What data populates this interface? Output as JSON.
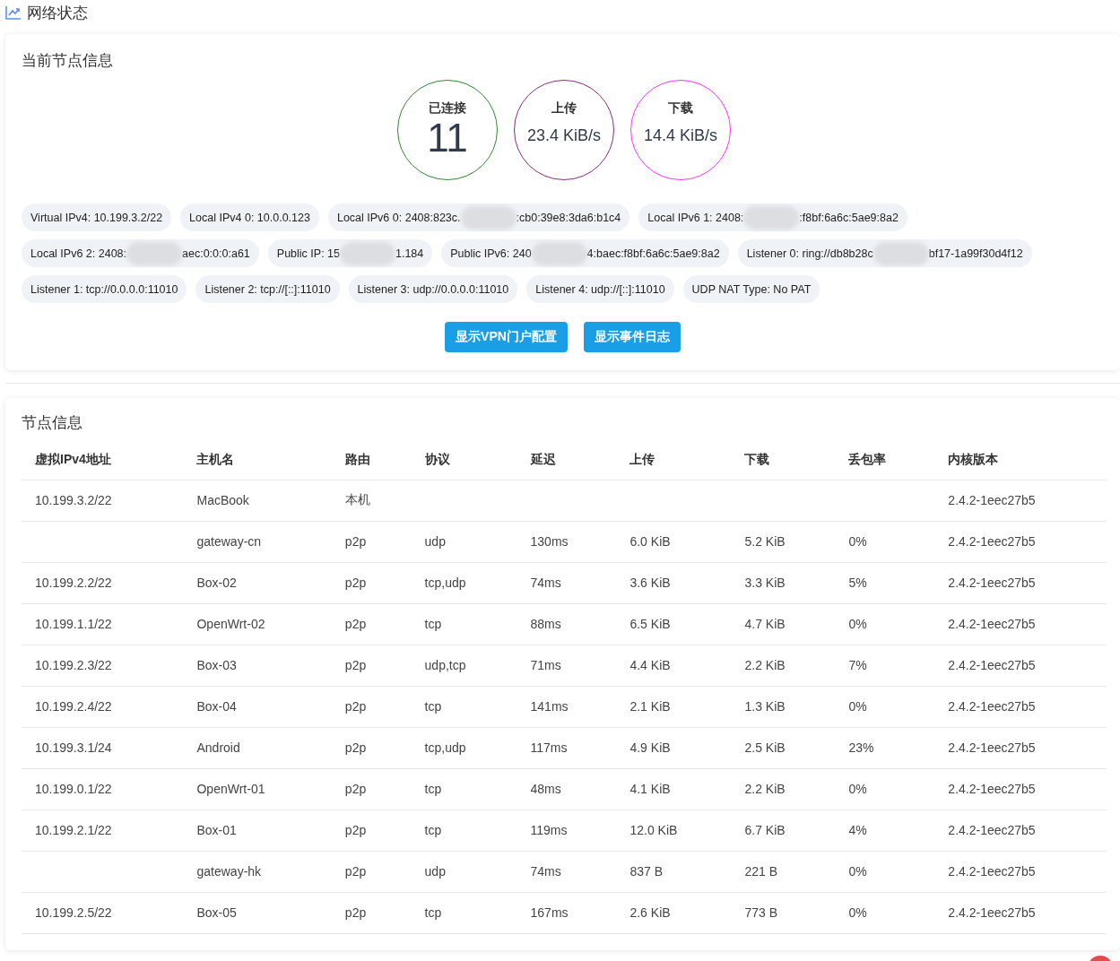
{
  "page_title": "网络状态",
  "node_card": {
    "title": "当前节点信息",
    "stats": [
      {
        "label": "已连接",
        "value": "11",
        "kind": "big",
        "color": "#2e8b2e"
      },
      {
        "label": "上传",
        "value": "23.4 KiB/s",
        "kind": "normal",
        "color": "#8b2a8b"
      },
      {
        "label": "下载",
        "value": "14.4 KiB/s",
        "kind": "normal",
        "color": "#ff33ff"
      }
    ],
    "chips": [
      {
        "parts": [
          "Virtual IPv4: 10.199.3.2/22"
        ]
      },
      {
        "parts": [
          "Local IPv4 0: 10.0.0.123"
        ]
      },
      {
        "parts": [
          "Local IPv6 0: 2408:823c.",
          ":cb0:39e8:3da6:b1c4"
        ]
      },
      {
        "parts": [
          "Local IPv6 1: 2408:",
          ":f8bf:6a6c:5ae9:8a2"
        ]
      },
      {
        "parts": [
          "Local IPv6 2: 2408:",
          "aec:0:0:0:a61"
        ]
      },
      {
        "parts": [
          "Public IP: 15",
          "1.184"
        ]
      },
      {
        "parts": [
          "Public IPv6: 240",
          "4:baec:f8bf:6a6c:5ae9:8a2"
        ]
      },
      {
        "parts": [
          "Listener 0: ring://db8b28c",
          "bf17-1a99f30d4f12"
        ]
      },
      {
        "parts": [
          "Listener 1: tcp://0.0.0.0:11010"
        ]
      },
      {
        "parts": [
          "Listener 2: tcp://[::]:11010"
        ]
      },
      {
        "parts": [
          "Listener 3: udp://0.0.0.0:11010"
        ]
      },
      {
        "parts": [
          "Listener 4: udp://[::]:11010"
        ]
      },
      {
        "parts": [
          "UDP NAT Type: No PAT"
        ]
      }
    ],
    "buttons": [
      "显示VPN门户配置",
      "显示事件日志"
    ]
  },
  "peers_card": {
    "title": "节点信息",
    "table": {
      "columns": [
        "虚拟IPv4地址",
        "主机名",
        "路由",
        "协议",
        "延迟",
        "上传",
        "下载",
        "丢包率",
        "内核版本"
      ],
      "rows": [
        [
          "10.199.3.2/22",
          "MacBook",
          "本机",
          "",
          "",
          "",
          "",
          "",
          "2.4.2-1eec27b5"
        ],
        [
          "",
          "gateway-cn",
          "p2p",
          "udp",
          "130ms",
          "6.0 KiB",
          "5.2 KiB",
          "0%",
          "2.4.2-1eec27b5"
        ],
        [
          "10.199.2.2/22",
          "Box-02",
          "p2p",
          "tcp,udp",
          "74ms",
          "3.6 KiB",
          "3.3 KiB",
          "5%",
          "2.4.2-1eec27b5"
        ],
        [
          "10.199.1.1/22",
          "OpenWrt-02",
          "p2p",
          "tcp",
          "88ms",
          "6.5 KiB",
          "4.7 KiB",
          "0%",
          "2.4.2-1eec27b5"
        ],
        [
          "10.199.2.3/22",
          "Box-03",
          "p2p",
          "udp,tcp",
          "71ms",
          "4.4 KiB",
          "2.2 KiB",
          "7%",
          "2.4.2-1eec27b5"
        ],
        [
          "10.199.2.4/22",
          "Box-04",
          "p2p",
          "tcp",
          "141ms",
          "2.1 KiB",
          "1.3 KiB",
          "0%",
          "2.4.2-1eec27b5"
        ],
        [
          "10.199.3.1/24",
          "Android",
          "p2p",
          "tcp,udp",
          "117ms",
          "4.9 KiB",
          "2.5 KiB",
          "23%",
          "2.4.2-1eec27b5"
        ],
        [
          "10.199.0.1/22",
          "OpenWrt-01",
          "p2p",
          "tcp",
          "48ms",
          "4.1 KiB",
          "2.2 KiB",
          "0%",
          "2.4.2-1eec27b5"
        ],
        [
          "10.199.2.1/22",
          "Box-01",
          "p2p",
          "tcp",
          "119ms",
          "12.0 KiB",
          "6.7 KiB",
          "4%",
          "2.4.2-1eec27b5"
        ],
        [
          "",
          "gateway-hk",
          "p2p",
          "udp",
          "74ms",
          "837 B",
          "221 B",
          "0%",
          "2.4.2-1eec27b5"
        ],
        [
          "10.199.2.5/22",
          "Box-05",
          "p2p",
          "tcp",
          "167ms",
          "2.6 KiB",
          "773 B",
          "0%",
          "2.4.2-1eec27b5"
        ]
      ]
    }
  }
}
